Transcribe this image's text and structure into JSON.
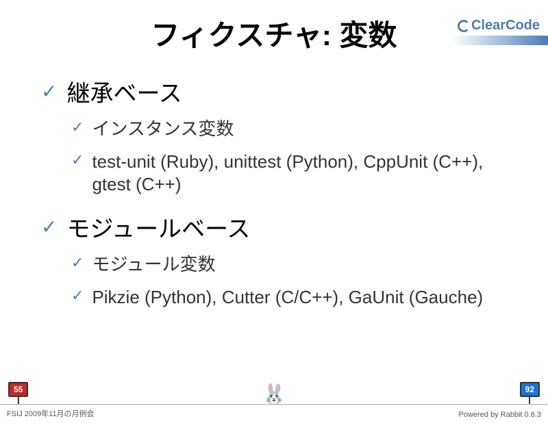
{
  "logo_text": "ClearCode",
  "title": "フィクスチャ: 変数",
  "bullets": [
    {
      "label": "継承ベース",
      "children": [
        {
          "label": "インスタンス変数"
        },
        {
          "label": "test-unit (Ruby), unittest (Python), CppUnit (C++), gtest (C++)"
        }
      ]
    },
    {
      "label": "モジュールベース",
      "children": [
        {
          "label": "モジュール変数"
        },
        {
          "label": "Pikzie (Python), Cutter (C/C++), GaUnit (Gauche)"
        }
      ]
    }
  ],
  "page_current": "55",
  "page_total": "92",
  "footer_left": "FSIJ 2009年11月の月例会",
  "footer_right": "Powered by Rabbit 0.6.3"
}
